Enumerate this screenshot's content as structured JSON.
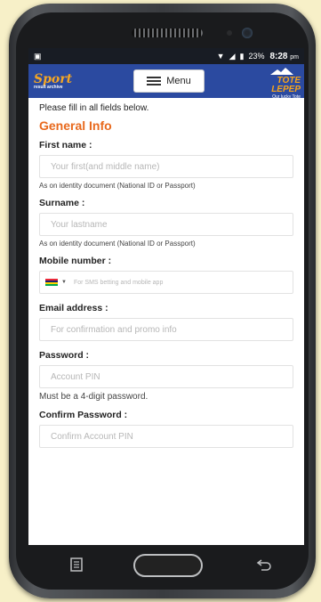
{
  "status_bar": {
    "battery": "23%",
    "time": "8:28",
    "ampm": "pm"
  },
  "header": {
    "logo_left": {
      "text": "Sport",
      "sub": "result archive"
    },
    "menu_label": "Menu",
    "logo_right": {
      "text": "TOTE LEPEP",
      "sub": "Our lucky Tote"
    }
  },
  "form": {
    "intro": "Please fill in all fields below.",
    "section_title": "General Info",
    "first_name": {
      "label": "First name :",
      "placeholder": "Your first(and middle name)",
      "hint": "As on identity document (National ID or Passport)"
    },
    "surname": {
      "label": "Surname :",
      "placeholder": "Your lastname",
      "hint": "As on identity document (National ID or Passport)"
    },
    "mobile": {
      "label": "Mobile number :",
      "placeholder": "For SMS betting and mobile app"
    },
    "email": {
      "label": "Email address :",
      "placeholder": "For confirmation and promo info"
    },
    "password": {
      "label": "Password :",
      "placeholder": "Account PIN",
      "hint": "Must be a 4-digit password."
    },
    "confirm_password": {
      "label": "Confirm Password :",
      "placeholder": "Confirm Account PIN"
    }
  },
  "colors": {
    "header_bg": "#2b4aa0",
    "accent": "#e8691d",
    "status_bg": "#181c24"
  },
  "icons": [
    "hamburger-menu-icon",
    "wifi-icon",
    "signal-icon",
    "battery-icon",
    "recent-apps-icon",
    "back-icon",
    "mauritius-flag-icon"
  ]
}
